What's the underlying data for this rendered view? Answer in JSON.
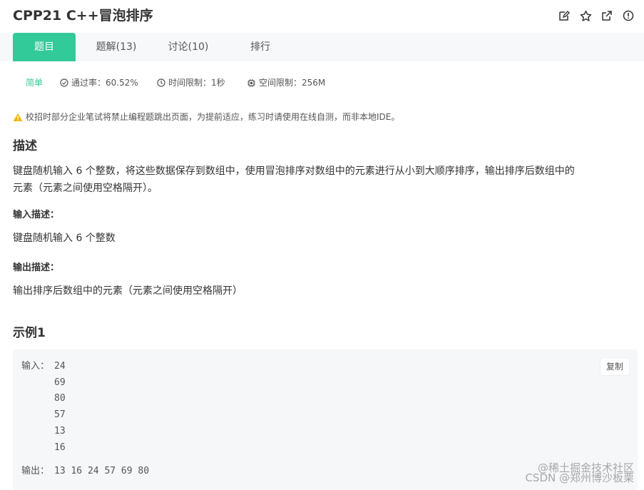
{
  "problem": {
    "title": "CPP21  C++冒泡排序",
    "actions": [
      {
        "name": "edit-icon"
      },
      {
        "name": "star-icon"
      },
      {
        "name": "external-link-icon"
      },
      {
        "name": "info-icon"
      }
    ]
  },
  "tabs": [
    {
      "label": "题目",
      "active": true
    },
    {
      "label": "题解(13)",
      "active": false
    },
    {
      "label": "讨论(10)",
      "active": false
    },
    {
      "label": "排行",
      "active": false
    }
  ],
  "meta": {
    "difficulty": "简单",
    "pass_rate": "通过率：60.52%",
    "time_limit": "时间限制：1秒",
    "space_limit": "空间限制：256M"
  },
  "notice": "校招时部分企业笔试将禁止编程题跳出页面，为提前适应，练习时请使用在线自测，而非本地IDE。",
  "description": {
    "heading": "描述",
    "line1": "键盘随机输入 6 个整数，将这些数据保存到数组中，使用冒泡排序对数组中的元素进行从小到大顺序排序，输出排序后数组中的",
    "line2": "元素（元素之间使用空格隔开）。"
  },
  "input_desc": {
    "heading": "输入描述：",
    "text": "键盘随机输入 6 个整数"
  },
  "output_desc": {
    "heading": "输出描述：",
    "text": "输出排序后数组中的元素（元素之间使用空格隔开）"
  },
  "example": {
    "heading": "示例1",
    "input_label": "输入：",
    "input_values": [
      "24",
      "69",
      "80",
      "57",
      "13",
      "16"
    ],
    "output_label": "输出：",
    "output_value": "13 16 24 57 69 80",
    "copy_label": "复制"
  },
  "watermark": {
    "line1": "@稀土掘金技术社区",
    "line2": "CSDN @郑州博沙板栗"
  },
  "colors": {
    "accent": "#32ca99",
    "warning": "#f5b400"
  }
}
